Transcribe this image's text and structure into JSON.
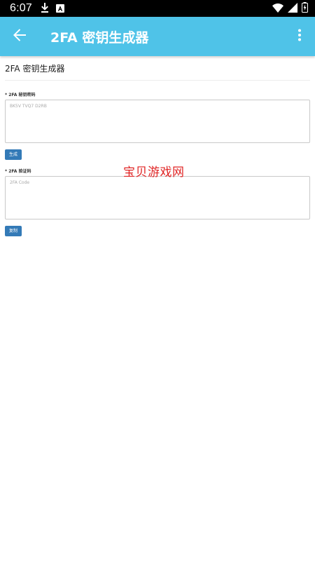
{
  "status_bar": {
    "time": "6:07",
    "icons": [
      "download-icon",
      "app-a-icon",
      "wifi-icon",
      "signal-icon",
      "battery-icon"
    ]
  },
  "app_bar": {
    "title": "2FA 密钥生成器",
    "back_icon": "arrow-back-icon",
    "menu_icon": "more-vert-icon",
    "color": "#4fc3e8"
  },
  "page": {
    "heading": "2FA 密钥生成器"
  },
  "secret_field": {
    "label": "* 2FA 秘钥密码",
    "placeholder": "BK5V TVQ7 D2RB",
    "value": ""
  },
  "generate_button": {
    "label": "生成",
    "color": "#337ab7"
  },
  "code_field": {
    "label": "* 2FA 验证码",
    "placeholder": "2FA Code",
    "value": ""
  },
  "copy_button": {
    "label": "复制",
    "color": "#337ab7"
  },
  "watermark": {
    "text": "宝贝游戏网",
    "color": "#e02424"
  }
}
